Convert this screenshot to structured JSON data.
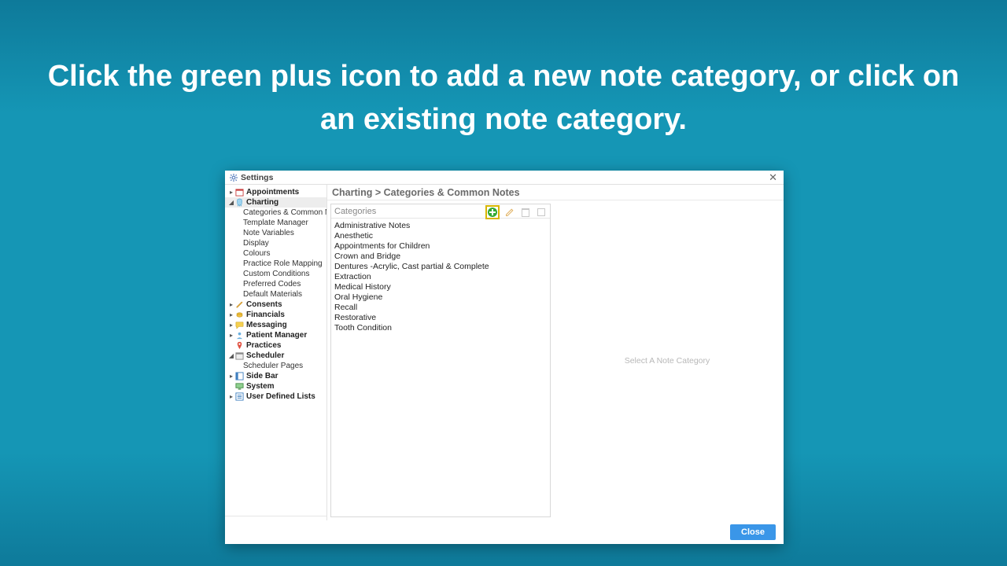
{
  "instruction": "Click the green plus icon to add a new note category, or click on an existing note category.",
  "window": {
    "title": "Settings",
    "close_button": "Close"
  },
  "breadcrumb": "Charting  >  Categories & Common Notes",
  "sidebar": {
    "items": [
      {
        "label": "Appointments",
        "icon": "calendar",
        "bold": true,
        "expander": "▸"
      },
      {
        "label": "Charting",
        "icon": "tooth",
        "bold": true,
        "expander": "◢",
        "selected": true
      },
      {
        "label": "Categories & Common Notes",
        "sub": true
      },
      {
        "label": "Template Manager",
        "sub": true
      },
      {
        "label": "Note Variables",
        "sub": true
      },
      {
        "label": "Display",
        "sub": true
      },
      {
        "label": "Colours",
        "sub": true
      },
      {
        "label": "Practice Role Mapping",
        "sub": true
      },
      {
        "label": "Custom Conditions",
        "sub": true
      },
      {
        "label": "Preferred Codes",
        "sub": true
      },
      {
        "label": "Default Materials",
        "sub": true
      },
      {
        "label": "Consents",
        "icon": "pencil",
        "bold": true,
        "expander": "▸"
      },
      {
        "label": "Financials",
        "icon": "coins",
        "bold": true,
        "expander": "▸"
      },
      {
        "label": "Messaging",
        "icon": "chat",
        "bold": true,
        "expander": "▸"
      },
      {
        "label": "Patient Manager",
        "icon": "patient",
        "bold": true,
        "expander": "▸"
      },
      {
        "label": "Practices",
        "icon": "pin",
        "bold": true,
        "expander": ""
      },
      {
        "label": "Scheduler",
        "icon": "schedule",
        "bold": true,
        "expander": "◢"
      },
      {
        "label": "Scheduler Pages",
        "sub": true
      },
      {
        "label": "Side Bar",
        "icon": "sidebar",
        "bold": true,
        "expander": "▸"
      },
      {
        "label": "System",
        "icon": "system",
        "bold": true,
        "expander": ""
      },
      {
        "label": "User Defined Lists",
        "icon": "list",
        "bold": true,
        "expander": "▸"
      }
    ]
  },
  "categories": {
    "header": "Categories",
    "placeholder": "Select A Note Category",
    "items": [
      "Administrative Notes",
      "Anesthetic",
      "Appointments for Children",
      "Crown and Bridge",
      "Dentures -Acrylic, Cast partial & Complete",
      "Extraction",
      "Medical History",
      "Oral Hygiene",
      "Recall",
      "Restorative",
      "Tooth Condition"
    ]
  },
  "icons": {
    "gear_color": "#5a7fbf",
    "add_highlight": "#d8b600",
    "add_fill": "#33aa33"
  }
}
